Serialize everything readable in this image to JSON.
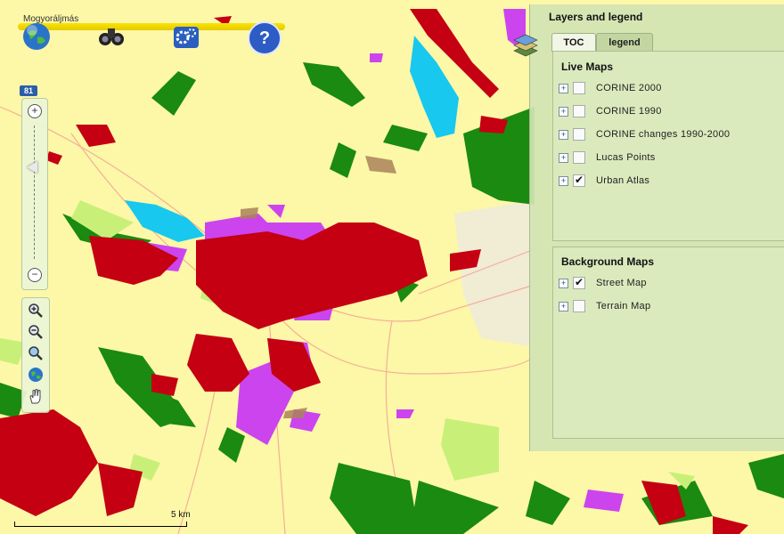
{
  "map": {
    "place_label": "Mogyoráljmás",
    "road_number": "81",
    "scale_label": "5 km"
  },
  "toolbar": {
    "icons": [
      "globe-icon",
      "binoculars-icon",
      "settings-icon",
      "help-icon"
    ],
    "help_glyph": "?"
  },
  "zoom": {
    "zoom_in_glyph": "+",
    "zoom_out_glyph": "−"
  },
  "nav_tools": [
    "zoom-in-magnifier-icon",
    "zoom-out-magnifier-icon",
    "zoom-extent-icon",
    "globe-small-icon",
    "pan-hand-icon"
  ],
  "layers_panel": {
    "title": "Layers and legend",
    "tabs": [
      {
        "label": "TOC",
        "active": true
      },
      {
        "label": "legend",
        "active": false
      }
    ],
    "live_maps": {
      "title": "Live Maps",
      "items": [
        {
          "label": "CORINE 2000",
          "checked": false
        },
        {
          "label": "CORINE 1990",
          "checked": false
        },
        {
          "label": "CORINE changes 1990-2000",
          "checked": false
        },
        {
          "label": "Lucas Points",
          "checked": false
        },
        {
          "label": "Urban Atlas",
          "checked": true
        }
      ]
    },
    "background_maps": {
      "title": "Background Maps",
      "items": [
        {
          "label": "Street Map",
          "checked": true
        },
        {
          "label": "Terrain Map",
          "checked": false
        }
      ]
    }
  },
  "colors": {
    "map_background": "#fdf7a8",
    "urban_red": "#c40012",
    "industrial_magenta": "#cc44ee",
    "forest_green": "#1a8a10",
    "water_cyan": "#18c8ee",
    "grassland_light_green": "#c8f078",
    "panel_green": "#d2e4b4"
  }
}
